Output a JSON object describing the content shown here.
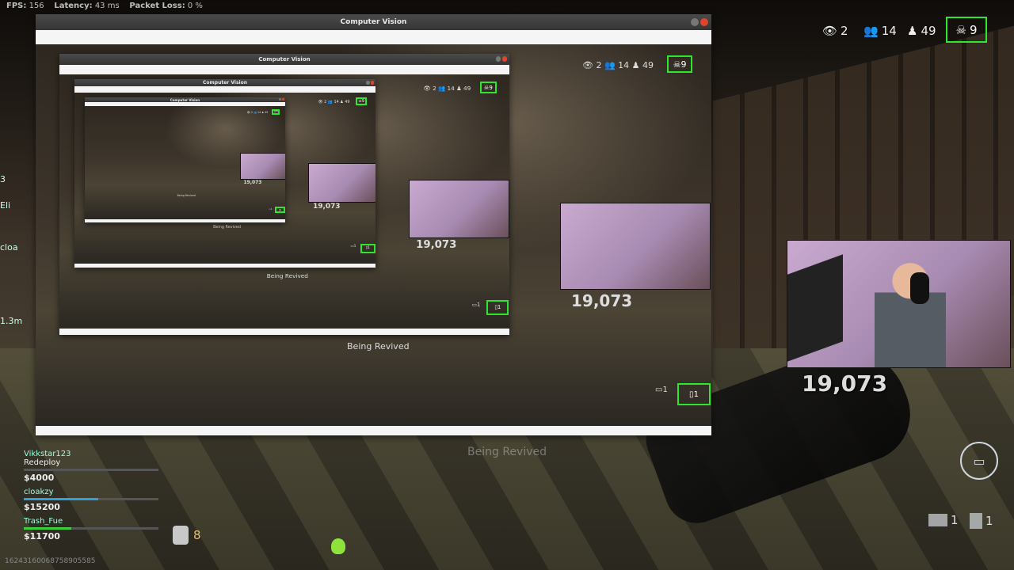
{
  "hud": {
    "fps_label": "FPS:",
    "fps_value": "156",
    "latency_label": "Latency:",
    "latency_value": "43 ms",
    "packet_loss_label": "Packet Loss:",
    "packet_loss_value": "0 %",
    "spectators": "2",
    "squads_remaining": "14",
    "players_remaining": "49",
    "kills": "9",
    "webcam_counter": "19,073",
    "armor_boxes": "1",
    "plates": "1",
    "plate_stack": "8",
    "status_text": "Being Revived",
    "session_id": "16243160068758905585",
    "left_names": [
      "3",
      "Eli",
      "cloa",
      "1.3m"
    ]
  },
  "squad": [
    {
      "name": "Vikkstar123",
      "status": "Redeploy",
      "money": "$4000",
      "bar_color": "#2ea0e0",
      "bar_fill": 0
    },
    {
      "name": "cloakzy",
      "status": "",
      "money": "$15200",
      "bar_color": "#2ea0e0",
      "bar_fill": 0.55
    },
    {
      "name": "Trash_Fue",
      "status": "",
      "money": "$11700",
      "bar_color": "#3bd13b",
      "bar_fill": 0.35
    }
  ],
  "windows": [
    {
      "title": "Computer Vision",
      "stats": {
        "spectators": "2",
        "squads": "14",
        "players": "49",
        "kills": "9"
      },
      "counter": "19,073",
      "armor": "1",
      "plates": "1",
      "revive": "Being Revived"
    },
    {
      "title": "Computer Vision",
      "stats": {
        "spectators": "2",
        "squads": "14",
        "players": "49",
        "kills": "9"
      },
      "counter": "19,073",
      "armor": "1",
      "plates": "1",
      "revive": "Being Revived"
    },
    {
      "title": "Computer Vision",
      "stats": {
        "spectators": "2",
        "squads": "14",
        "players": "49",
        "kills": "9"
      },
      "counter": "19,073",
      "armor": "1",
      "plates": "1",
      "revive": "Being Revived"
    },
    {
      "title": "Computer Vision",
      "stats": {
        "spectators": "2",
        "squads": "14",
        "players": "49",
        "kills": "9"
      },
      "counter": "19,073",
      "armor": "1",
      "plates": "1",
      "revive": "Being Revived"
    }
  ],
  "colors": {
    "detection_box": "#2fe62f",
    "close_button": "#e0452a",
    "title_bar": "#3e3e3e"
  }
}
